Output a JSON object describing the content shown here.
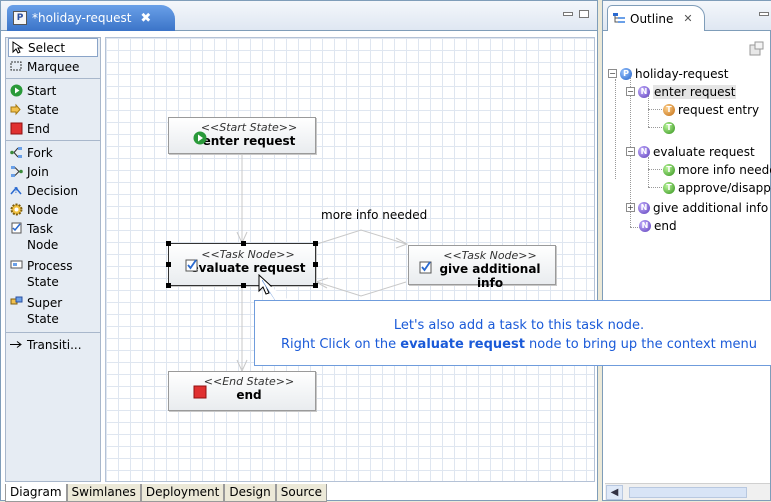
{
  "editor": {
    "tab_label": "*holiday-request",
    "tab_close": "✖"
  },
  "palette": {
    "items": [
      {
        "label": "Select",
        "icon": "pointer-icon"
      },
      {
        "label": "Marquee",
        "icon": "marquee-icon"
      },
      {
        "label": "Start",
        "icon": "start-icon"
      },
      {
        "label": "State",
        "icon": "state-icon"
      },
      {
        "label": "End",
        "icon": "end-icon"
      },
      {
        "label": "Fork",
        "icon": "fork-icon"
      },
      {
        "label": "Join",
        "icon": "join-icon"
      },
      {
        "label": "Decision",
        "icon": "decision-icon"
      },
      {
        "label": "Node",
        "icon": "node-icon"
      },
      {
        "label": "Task\nNode",
        "icon": "task-node-icon"
      },
      {
        "label": "Process\nState",
        "icon": "process-state-icon"
      },
      {
        "label": "Super\nState",
        "icon": "super-state-icon"
      },
      {
        "label": "Transiti...",
        "icon": "transition-icon"
      }
    ]
  },
  "diagram": {
    "start_node": {
      "stereotype": "<<Start State>>",
      "name": "enter request"
    },
    "task_node_1": {
      "stereotype": "<<Task Node>>",
      "name": "evaluate request"
    },
    "task_node_2": {
      "stereotype": "<<Task Node>>",
      "name": "give additional info"
    },
    "end_node": {
      "stereotype": "<<End State>>",
      "name": "end"
    },
    "transition_label": "more info needed"
  },
  "callout": {
    "line1": "Let's also add a task to this task node.",
    "line2_pre": "Right Click on the ",
    "line2_bold": "evaluate request",
    "line2_post": " node to bring up the context menu"
  },
  "bottom_tabs": [
    "Diagram",
    "Swimlanes",
    "Deployment",
    "Design",
    "Source"
  ],
  "outline": {
    "tab_label": "Outline",
    "tab_close": "✕",
    "tree": [
      {
        "label": "holiday-request"
      },
      {
        "label": "enter request"
      },
      {
        "label": "request entry"
      },
      {
        "label": ""
      },
      {
        "label": "evaluate request"
      },
      {
        "label": "more info needed"
      },
      {
        "label": "approve/disapprove"
      },
      {
        "label": "give additional info"
      },
      {
        "label": "end"
      }
    ]
  }
}
